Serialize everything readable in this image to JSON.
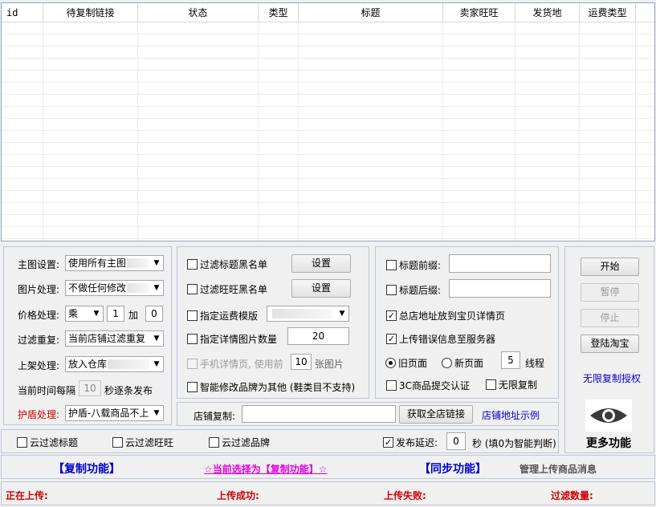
{
  "grid": {
    "columns": [
      "id",
      "待复制链接",
      "状态",
      "类型",
      "标题",
      "卖家旺旺",
      "发货地",
      "运费类型"
    ]
  },
  "left_panel": {
    "main_image": {
      "label": "主图设置:",
      "value": "使用所有主图"
    },
    "image_proc": {
      "label": "图片处理:",
      "value": "不做任何修改"
    },
    "price": {
      "label": "价格处理:",
      "op": "乘",
      "multiplier": "1",
      "add_label": "加",
      "add_value": "0"
    },
    "dedupe": {
      "label": "过滤重复:",
      "value": "当前店铺过滤重复"
    },
    "listing": {
      "label": "上架处理:",
      "value": "放入仓库"
    },
    "interval": {
      "prefix": "当前时间每隔",
      "value": "10",
      "suffix": "秒逐条发布"
    },
    "shield": {
      "label": "护盾处理:",
      "value": "护盾-八载商品不上"
    }
  },
  "mid_panel": {
    "title_blacklist": {
      "label": "过滤标题黑名单",
      "button": "设置"
    },
    "wangwang_blacklist": {
      "label": "过滤旺旺黑名单",
      "button": "设置"
    },
    "freight_template": {
      "label": "指定运费模版"
    },
    "detail_image_count": {
      "label": "指定详情图片数量",
      "value": "20"
    },
    "mobile_detail": {
      "label": "手机详情页, 使用前",
      "value": "10",
      "suffix": "张图片"
    },
    "smart_brand": {
      "label": "智能修改品牌为其他 (鞋类目不支持)"
    }
  },
  "shop_copy": {
    "label": "店铺复制:",
    "value": "",
    "button": "获取全店链接",
    "example_link": "店铺地址示例"
  },
  "right_panel": {
    "title_prefix": {
      "label": "标题前缀:",
      "value": ""
    },
    "title_suffix": {
      "label": "标题后缀:",
      "value": ""
    },
    "shop_address": {
      "label": "总店地址放到宝贝详情页",
      "checked": true
    },
    "upload_errors": {
      "label": "上传错误信息至服务器",
      "checked": true
    },
    "old_page": {
      "label": "旧页面"
    },
    "new_page": {
      "label": "新页面"
    },
    "threads": {
      "value": "5",
      "label": "线程"
    },
    "cert_3c": {
      "label": "3C商品提交认证"
    },
    "unlimited_copy": {
      "label": "无限复制"
    }
  },
  "control_panel": {
    "start": "开始",
    "pause": "暂停",
    "stop": "停止",
    "login": "登陆淘宝",
    "license_link": "无限复制授权",
    "more": "更多功能",
    "eye_icon": "eye-icon"
  },
  "filter_bar": {
    "cloud_title": "云过滤标题",
    "cloud_wangwang": "云过滤旺旺",
    "cloud_brand": "云过滤品牌",
    "publish_delay": {
      "label": "发布延迟:",
      "value": "0",
      "suffix": "秒 (填0为智能判断)"
    }
  },
  "func_bar": {
    "copy": "【复制功能】",
    "current": "☆当前选择为【复制功能】☆",
    "sync": "【同步功能】",
    "watermark": "管理上传商品消息"
  },
  "status_bar": {
    "uploading": "正在上传:",
    "success": "上传成功:",
    "fail": "上传失败:",
    "filtered": "过滤数量:"
  },
  "colors": {
    "red": "#d00000",
    "link_blue": "#0000cc",
    "magenta": "#e000e0"
  }
}
